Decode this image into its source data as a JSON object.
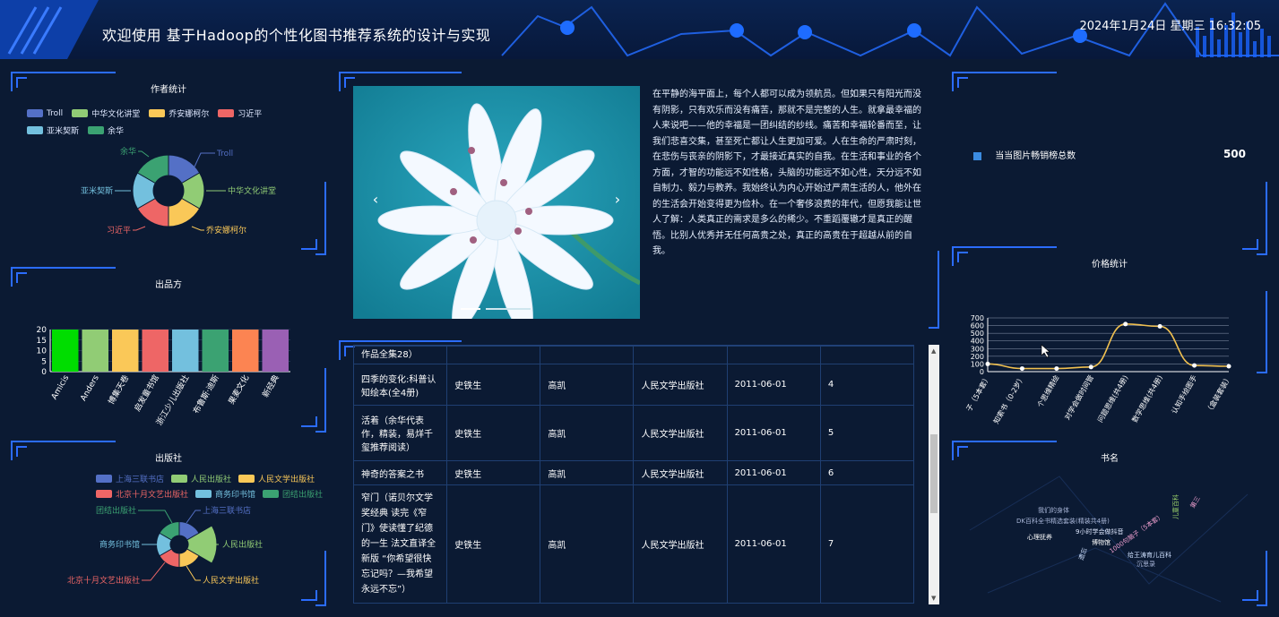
{
  "header": {
    "title": "欢迎使用 基于Hadoop的个性化图书推荐系统的设计与实现",
    "clock": "2024年1月24日 星期三 16:32:05"
  },
  "author_panel": {
    "title": "作者统计",
    "legend": [
      {
        "label": "Troll",
        "color": "#5470c6"
      },
      {
        "label": "中华文化讲堂",
        "color": "#91cc75"
      },
      {
        "label": "乔安娜柯尔",
        "color": "#fac858"
      },
      {
        "label": "习近平",
        "color": "#ee6666"
      },
      {
        "label": "亚米契斯",
        "color": "#73c0de"
      },
      {
        "label": "余华",
        "color": "#3ba272"
      }
    ],
    "labels": [
      "Troll",
      "中华文化讲堂",
      "乔安娜柯尔",
      "习近平",
      "亚米契斯",
      "余华"
    ]
  },
  "publisher_party_panel": {
    "title": "出品方",
    "yticks": [
      "20",
      "15",
      "10",
      "5",
      "0"
    ],
    "categories": [
      "Amicis",
      "Anders",
      "博集天卷",
      "启发童书馆",
      "浙江少儿出版社",
      "布鲁斯·迪斯",
      "果麦文化",
      "新经典"
    ],
    "colors": [
      "#00dd00",
      "#91cc75",
      "#fac858",
      "#ee6666",
      "#73c0de",
      "#3ba272",
      "#fc8452",
      "#9a60b4"
    ]
  },
  "press_panel": {
    "title": "出版社",
    "legend": [
      {
        "label": "上海三联书店",
        "color": "#5470c6"
      },
      {
        "label": "人民出版社",
        "color": "#91cc75"
      },
      {
        "label": "人民文学出版社",
        "color": "#fac858"
      },
      {
        "label": "北京十月文艺出版社",
        "color": "#ee6666"
      },
      {
        "label": "商务印书馆",
        "color": "#73c0de"
      },
      {
        "label": "团结出版社",
        "color": "#3ba272"
      }
    ],
    "labels": [
      "团结出版社",
      "上海三联书店",
      "商务印书馆",
      "人民出版社",
      "北京十月文艺出版社",
      "人民文学出版社"
    ]
  },
  "center": {
    "carousel_prev": "‹",
    "carousel_next": "›",
    "description": "在平静的海平面上，每个人都可以成为领航员。但如果只有阳光而没有阴影，只有欢乐而没有痛苦，那就不是完整的人生。就拿最幸福的人来说吧——他的幸福是一团纠结的纱线。痛苦和幸福轮番而至，让我们悲喜交集，甚至死亡都让人生更加可爱。人在生命的严肃时刻，在悲伤与丧亲的阴影下，才最接近真实的自我。在生活和事业的各个方面，才智的功能远不如性格，头脑的功能远不如心性，天分远不如自制力、毅力与教养。我始终认为内心开始过严肃生活的人，他外在的生活会开始变得更为俭朴。在一个奢侈浪费的年代，但愿我能让世人了解：人类真正的需求是多么的稀少。不重蹈覆辙才是真正的醒悟。比别人优秀并无任何高贵之处，真正的高贵在于超越从前的自我。"
  },
  "table": {
    "top_fragment": "作品全集28）",
    "rows": [
      {
        "title": "四季的变化:科普认知绘本(全4册)",
        "author": "史铁生",
        "editor": "高凯",
        "press": "人民文学出版社",
        "date": "2011-06-01",
        "no": "4"
      },
      {
        "title": "活着（余华代表作，精装，易烊千玺推荐阅读）",
        "author": "史铁生",
        "editor": "高凯",
        "press": "人民文学出版社",
        "date": "2011-06-01",
        "no": "5"
      },
      {
        "title": "神奇的答案之书",
        "author": "史铁生",
        "editor": "高凯",
        "press": "人民文学出版社",
        "date": "2011-06-01",
        "no": "6"
      },
      {
        "title": "窄门（诺贝尔文学奖经典 读完《窄门》使读懂了纪德的一生 法文直译全新版 “你希望很快忘记吗？—我希望永远不忘”）",
        "author": "史铁生",
        "editor": "高凯",
        "press": "人民文学出版社",
        "date": "2011-06-01",
        "no": "7"
      }
    ]
  },
  "stat_panel": {
    "label": "当当图片畅销榜总数",
    "value": "500",
    "bullet_color": "#3b8be0"
  },
  "price_panel": {
    "title": "价格统计",
    "yticks": [
      "700",
      "600",
      "500",
      "400",
      "300",
      "200",
      "100",
      "0"
    ],
    "categories": [
      "子（5本套）",
      "知索书（0-2岁）",
      "个思维精绘",
      "对学会做时间管",
      "问题思维(共4册)",
      "数学思维(共4册)",
      "认知手绘图手",
      "（盒装套装）"
    ]
  },
  "bookname_panel": {
    "title": "书名",
    "words": [
      {
        "text": "我们的身体",
        "color": "#a9b6d8"
      },
      {
        "text": "DK百科全书精选套装(精装共4册)",
        "color": "#a9b6d8"
      },
      {
        "text": "9小时学会做抖音",
        "color": "#dfe8ff"
      },
      {
        "text": "心理抚养",
        "color": "#ffffff"
      },
      {
        "text": "博物馆",
        "color": "#ffffff"
      },
      {
        "text": "1000句脑子（5本套）",
        "color": "#f0a0d0"
      },
      {
        "text": "儿童百科",
        "color": "#9ad06a"
      },
      {
        "text": "第三",
        "color": "#f0a0d0"
      },
      {
        "text": "给王涛育儿百科",
        "color": "#cfe1ff"
      },
      {
        "text": "沉思录",
        "color": "#a9b6d8"
      },
      {
        "text": "遗忘",
        "color": "#cfe1ff"
      }
    ]
  },
  "chart_data": [
    {
      "type": "pie",
      "title": "作者统计",
      "categories": [
        "Troll",
        "中华文化讲堂",
        "乔安娜柯尔",
        "习近平",
        "亚米契斯",
        "余华"
      ],
      "values": [
        1,
        1,
        1,
        1,
        1,
        1
      ]
    },
    {
      "type": "bar",
      "title": "出品方",
      "categories": [
        "Amicis",
        "Anders",
        "博集天卷",
        "启发童书馆",
        "浙江少儿出版社",
        "布鲁斯·迪斯",
        "果麦文化",
        "新经典"
      ],
      "values": [
        20,
        20,
        20,
        20,
        20,
        20,
        20,
        20
      ],
      "ylim": [
        0,
        20
      ]
    },
    {
      "type": "pie",
      "title": "出版社",
      "categories": [
        "上海三联书店",
        "人民出版社",
        "人民文学出版社",
        "北京十月文艺出版社",
        "商务印书馆",
        "团结出版社"
      ],
      "values": [
        1,
        4,
        1,
        1,
        1,
        1
      ]
    },
    {
      "type": "line",
      "title": "价格统计",
      "categories": [
        "子（5本套）",
        "知索书（0-2岁）",
        "个思维精绘",
        "对学会做时间管",
        "问题思维(共4册)",
        "数学思维(共4册)",
        "认知手绘图手",
        "（盒装套装）"
      ],
      "values": [
        100,
        40,
        40,
        60,
        620,
        590,
        80,
        70
      ],
      "ylim": [
        0,
        700
      ]
    }
  ]
}
